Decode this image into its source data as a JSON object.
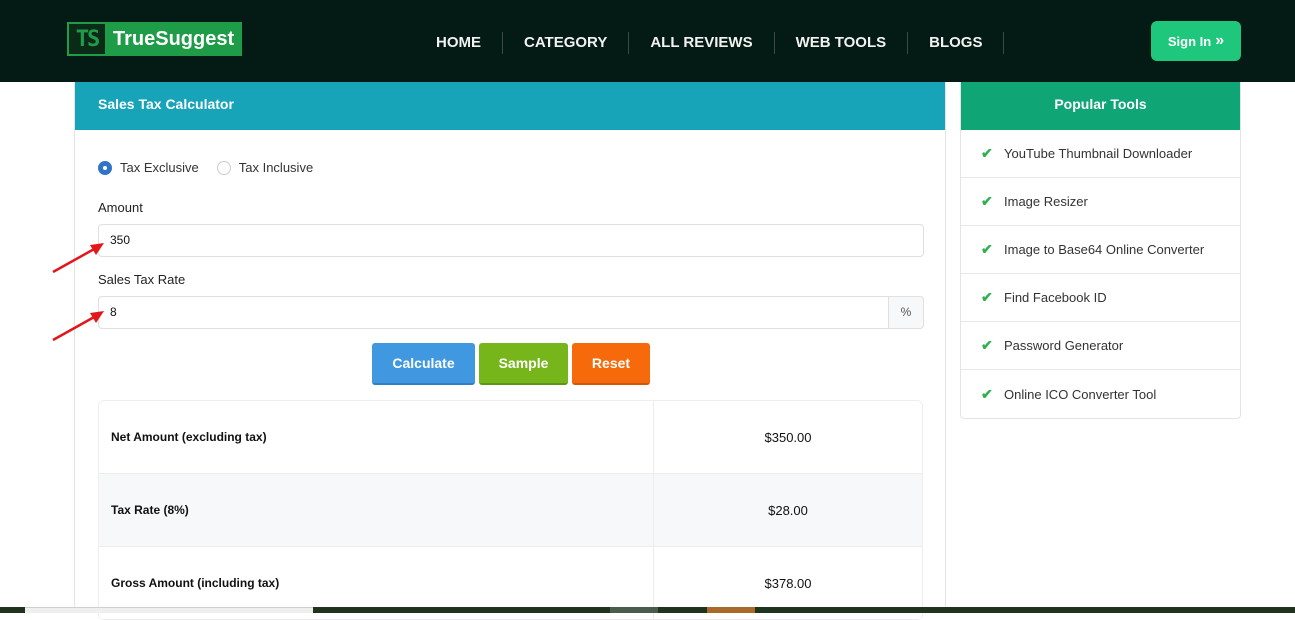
{
  "header": {
    "logo_mark": "TS",
    "logo_text": "TrueSuggest",
    "nav": [
      "HOME",
      "CATEGORY",
      "ALL REVIEWS",
      "WEB TOOLS",
      "BLOGS"
    ],
    "signin_label": "Sign In",
    "signin_icon": "»"
  },
  "calculator": {
    "title": "Sales Tax Calculator",
    "modes": [
      {
        "label": "Tax Exclusive",
        "selected": true
      },
      {
        "label": "Tax Inclusive",
        "selected": false
      }
    ],
    "amount_label": "Amount",
    "amount_value": "350",
    "rate_label": "Sales Tax Rate",
    "rate_value": "8",
    "rate_suffix": "%",
    "buttons": {
      "calculate": "Calculate",
      "sample": "Sample",
      "reset": "Reset"
    },
    "results": [
      {
        "label": "Net Amount (excluding tax)",
        "value": "$350.00"
      },
      {
        "label": "Tax Rate (8%)",
        "value": "$28.00"
      },
      {
        "label": "Gross Amount (including tax)",
        "value": "$378.00"
      }
    ]
  },
  "sidebar": {
    "title": "Popular Tools",
    "items": [
      "YouTube Thumbnail Downloader",
      "Image Resizer",
      "Image to Base64 Online Converter",
      "Find Facebook ID",
      "Password Generator",
      "Online ICO Converter Tool"
    ]
  },
  "colors": {
    "header_bg": "#041a14",
    "accent_teal": "#17a3b8",
    "accent_green": "#0fa574",
    "signin": "#1ec77c",
    "calculate": "#4099e0",
    "sample": "#76b61b",
    "reset": "#f76a0b",
    "annotation_arrow": "#e3161b"
  }
}
